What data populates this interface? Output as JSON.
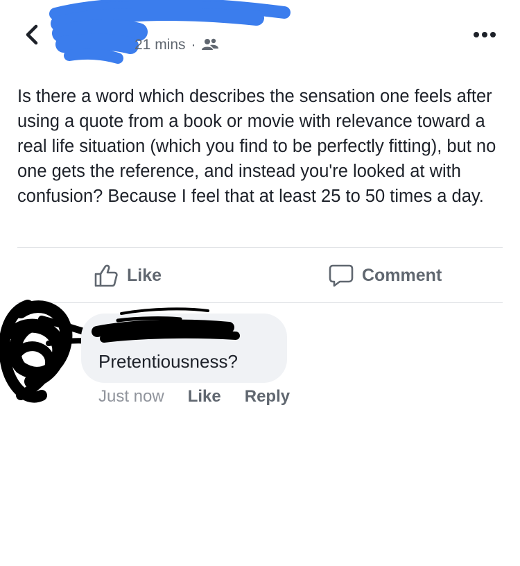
{
  "header": {
    "time_ago": "21 mins",
    "separator": "·",
    "audience_icon": "friends-icon"
  },
  "post": {
    "text": "Is there a word which describes the sensation one feels after using a quote from a book or movie with relevance toward a real life situation (which you find to be perfectly fitting), but no one gets the reference, and instead you're looked at with confusion? Because I feel that at least 25 to 50 times a day."
  },
  "actions": {
    "like_label": "Like",
    "comment_label": "Comment"
  },
  "comment": {
    "text": "Pretentiousness?",
    "time": "Just now",
    "like_label": "Like",
    "reply_label": "Reply"
  },
  "colors": {
    "redaction_blue": "#3b7ded",
    "redaction_black": "#000000",
    "muted_text": "#606770",
    "bubble_bg": "#f0f2f5"
  }
}
